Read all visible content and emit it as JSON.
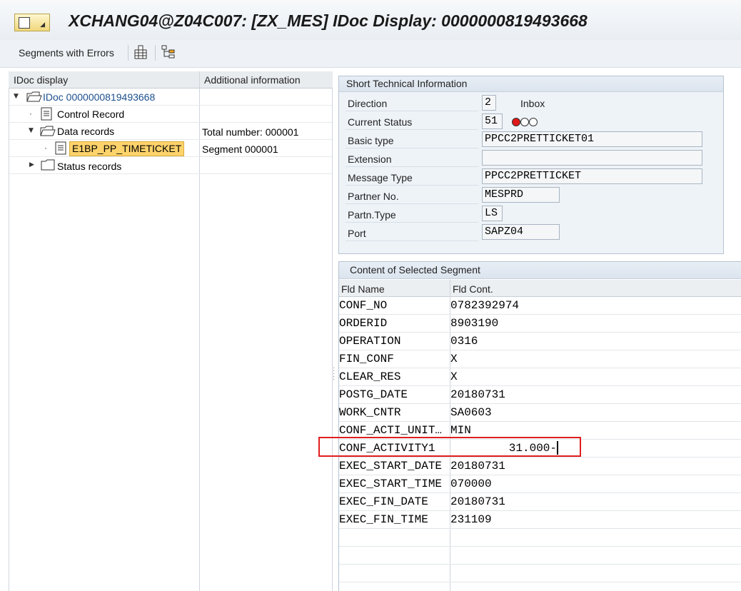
{
  "window": {
    "title": "XCHANG04@Z04C007: [ZX_MES] IDoc Display: 0000000819493668"
  },
  "toolbar": {
    "segments_with_errors": "Segments with Errors",
    "icons": [
      "grid-icon",
      "hierarchy-icon"
    ]
  },
  "tree": {
    "col_idoc": "IDoc display",
    "col_additional": "Additional information",
    "nodes": [
      {
        "label": "IDoc 0000000819493668",
        "info": "",
        "icon": "folder-open-icon"
      },
      {
        "label": "Control Record",
        "info": "",
        "icon": "document-icon"
      },
      {
        "label": "Data records",
        "info": "Total number: 000001",
        "icon": "folder-open-icon"
      },
      {
        "label": "E1BP_PP_TIMETICKET",
        "info": "Segment 000001",
        "icon": "document-icon"
      },
      {
        "label": "Status records",
        "info": "",
        "icon": "folder-icon"
      }
    ]
  },
  "short_info": {
    "title": "Short Technical Information",
    "direction_label": "Direction",
    "direction_value": "2",
    "direction_text": "Inbox",
    "status_label": "Current Status",
    "status_value": "51",
    "basic_type_label": "Basic type",
    "basic_type_value": "PPCC2PRETTICKET01",
    "extension_label": "Extension",
    "extension_value": "",
    "message_type_label": "Message Type",
    "message_type_value": "PPCC2PRETTICKET",
    "partner_no_label": "Partner No.",
    "partner_no_value": "MESPRD",
    "partn_type_label": "Partn.Type",
    "partn_type_value": "LS",
    "port_label": "Port",
    "port_value": "SAPZ04",
    "status_light_color": "#e01818"
  },
  "segment": {
    "title": "Content of Selected Segment",
    "col_name": "Fld Name",
    "col_content": "Fld Cont.",
    "rows": [
      {
        "name": "CONF_NO",
        "value": "0782392974"
      },
      {
        "name": "ORDERID",
        "value": "8903190"
      },
      {
        "name": "OPERATION",
        "value": "0316"
      },
      {
        "name": "FIN_CONF",
        "value": "X"
      },
      {
        "name": "CLEAR_RES",
        "value": "X"
      },
      {
        "name": "POSTG_DATE",
        "value": "20180731"
      },
      {
        "name": "WORK_CNTR",
        "value": "SA0603"
      },
      {
        "name": "CONF_ACTI_UNIT…",
        "value": "MIN"
      },
      {
        "name": "CONF_ACTIVITY1",
        "value": "31.000-"
      },
      {
        "name": "EXEC_START_DATE",
        "value": "20180731"
      },
      {
        "name": "EXEC_START_TIME",
        "value": "070000"
      },
      {
        "name": "EXEC_FIN_DATE",
        "value": "20180731"
      },
      {
        "name": "EXEC_FIN_TIME",
        "value": "231109"
      }
    ]
  }
}
